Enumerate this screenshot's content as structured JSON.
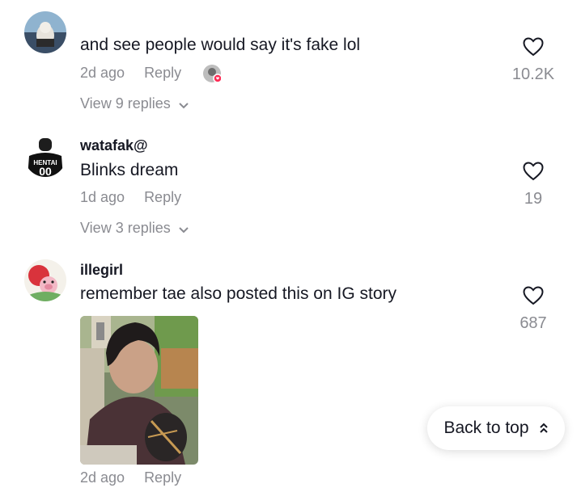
{
  "comments": [
    {
      "username": "",
      "text": "and see people would say it's fake lol",
      "time": "2d ago",
      "reply_label": "Reply",
      "view_replies": "View 9 replies",
      "likes": "10.2K"
    },
    {
      "username": "watafak@",
      "avatar_text": "HENTAI",
      "text": "Blinks dream",
      "time": "1d ago",
      "reply_label": "Reply",
      "view_replies": "View 3 replies",
      "likes": "19"
    },
    {
      "username": "illegirl",
      "text": "remember tae also posted this on IG story",
      "time": "2d ago",
      "reply_label": "Reply",
      "likes": "687"
    }
  ],
  "back_to_top": {
    "label": "Back to top"
  },
  "colors": {
    "text": "#161823",
    "muted": "#8a8b91",
    "like_badge": "#fe2c55"
  },
  "icons": {
    "heart": "heart-outline-icon",
    "chevron": "chevron-down-icon",
    "back": "double-chevron-up-icon"
  }
}
